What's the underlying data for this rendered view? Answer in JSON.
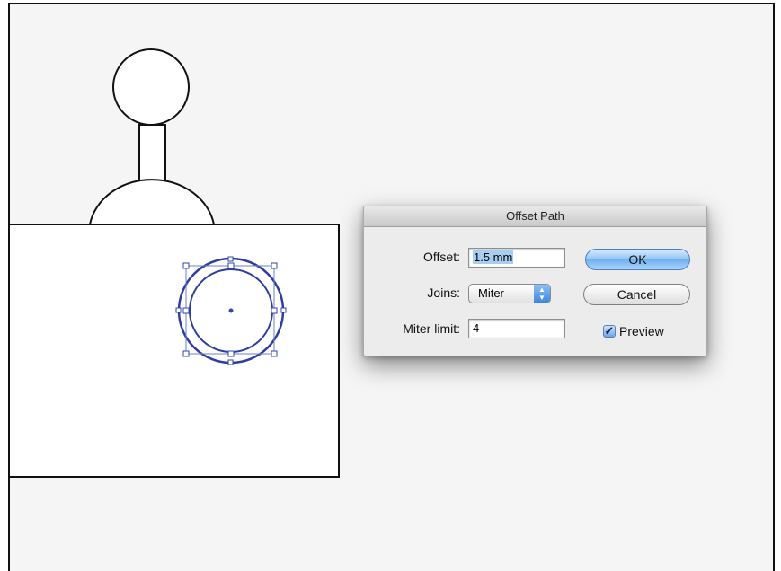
{
  "dialog": {
    "title": "Offset Path",
    "offset_label": "Offset:",
    "offset_value": "1.5 mm",
    "joins_label": "Joins:",
    "joins_value": "Miter",
    "miter_limit_label": "Miter limit:",
    "miter_limit_value": "4",
    "ok_label": "OK",
    "cancel_label": "Cancel",
    "preview_label": "Preview",
    "preview_checked": true
  },
  "icons": [
    "select-arrows-icon",
    "checkmark-icon",
    "center-point-icon"
  ],
  "colors": {
    "selection": "#3346a8",
    "default_button": "#8ec3f5",
    "canvas": "#f5f5f5"
  }
}
